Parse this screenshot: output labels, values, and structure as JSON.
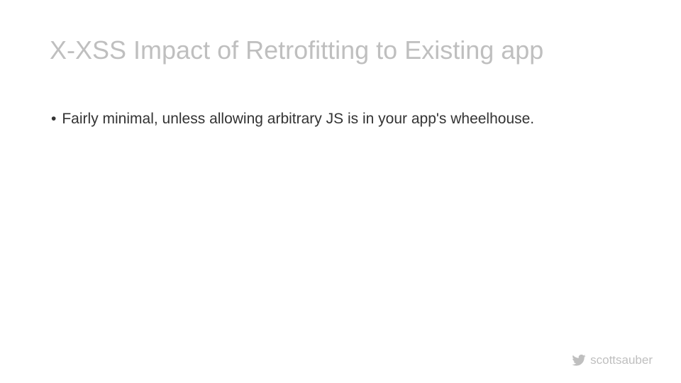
{
  "slide": {
    "title": "X-XSS Impact of Retrofitting to Existing app",
    "bullets": [
      "Fairly minimal, unless allowing arbitrary JS is in your app's wheelhouse."
    ]
  },
  "footer": {
    "handle": "scottsauber",
    "icon": "twitter-icon"
  }
}
